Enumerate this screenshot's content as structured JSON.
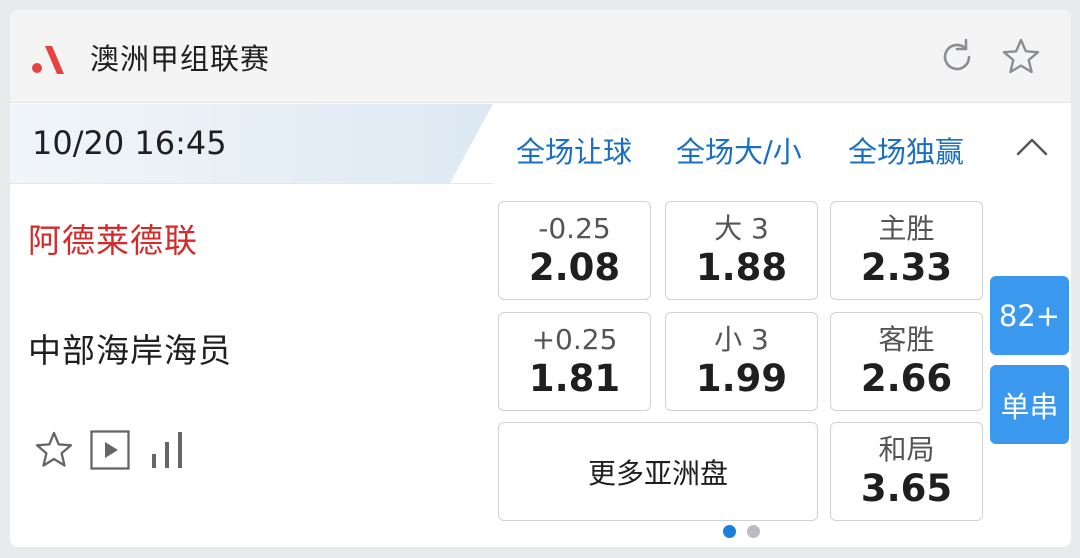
{
  "header": {
    "league_name": "澳洲甲组联赛",
    "logo_icon": "league-logo-icon",
    "refresh_icon": "refresh-icon",
    "favorite_icon": "star-outline-icon"
  },
  "match": {
    "time": "10/20 16:45",
    "home_team": "阿德莱德联",
    "away_team": "中部海岸海员"
  },
  "tabs": [
    {
      "label": "全场让球"
    },
    {
      "label": "全场大/小"
    },
    {
      "label": "全场独赢"
    }
  ],
  "odds": {
    "handicap": [
      {
        "label": "-0.25",
        "value": "2.08"
      },
      {
        "label": "+0.25",
        "value": "1.81"
      }
    ],
    "over_under": [
      {
        "label": "大 3",
        "value": "1.88"
      },
      {
        "label": "小 3",
        "value": "1.99"
      }
    ],
    "moneyline": [
      {
        "label": "主胜",
        "value": "2.33"
      },
      {
        "label": "客胜",
        "value": "2.66"
      },
      {
        "label": "和局",
        "value": "3.65"
      }
    ]
  },
  "more_asian_label": "更多亚洲盘",
  "side_buttons": {
    "more_markets": "82+",
    "single_parlay": "单串"
  },
  "pagination": {
    "pages": 2,
    "active": 1
  },
  "colors": {
    "accent_blue": "#1a6fc2",
    "button_blue": "#3a98ee",
    "home_red": "#d42a2a",
    "logo_red": "#e8423f"
  }
}
